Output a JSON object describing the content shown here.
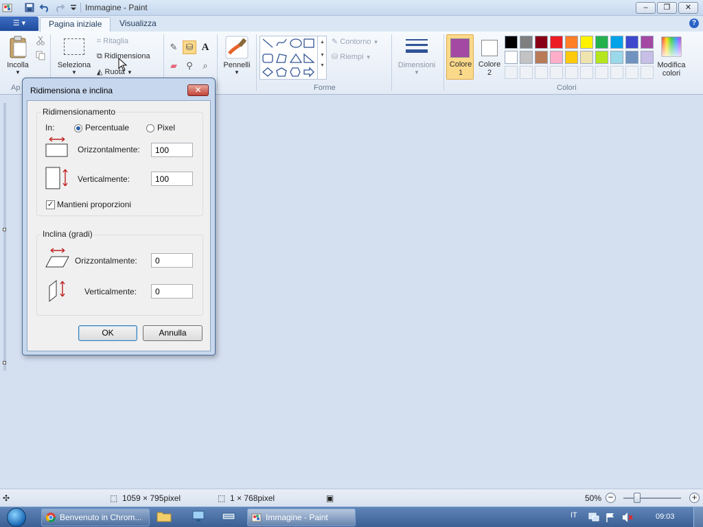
{
  "window": {
    "title": "Immagine - Paint",
    "controls": {
      "minimize": "–",
      "maximize": "❐",
      "close": "✕"
    }
  },
  "ribbon": {
    "tabs": [
      "Pagina iniziale",
      "Visualizza"
    ],
    "active_tab": "Pagina iniziale",
    "clipboard": {
      "paste_label": "Incolla",
      "group_label_partial": "Ap"
    },
    "image": {
      "select_label": "Seleziona",
      "crop_label": "Ritaglia",
      "resize_label": "Ridimensiona",
      "rotate_label": "Ruota"
    },
    "brushes_label": "Pennelli",
    "shapes": {
      "group_label": "Forme",
      "outline_label": "Contorno",
      "fill_label": "Riempi"
    },
    "size_label": "Dimensioni",
    "colors": {
      "group_label": "Colori",
      "color1_label": "Colore",
      "color1_num": "1",
      "color2_label": "Colore",
      "color2_num": "2",
      "edit_label_1": "Modifica",
      "edit_label_2": "colori",
      "color1_value": "#a349a4",
      "color2_value": "#ffffff",
      "palette_row1": [
        "#000000",
        "#7f7f7f",
        "#880015",
        "#ed1c24",
        "#ff7f27",
        "#fff200",
        "#22b14c",
        "#00a2e8",
        "#3f48cc",
        "#a349a4"
      ],
      "palette_row2": [
        "#ffffff",
        "#c3c3c3",
        "#b97a57",
        "#ffaec9",
        "#ffc90e",
        "#efe4b0",
        "#b5e61d",
        "#99d9ea",
        "#7092be",
        "#c8bfe7"
      ]
    }
  },
  "dialog": {
    "title": "Ridimensiona e inclina",
    "close": "✕",
    "resize": {
      "legend": "Ridimensionamento",
      "by_label": "In:",
      "option_percent": "Percentuale",
      "option_pixel": "Pixel",
      "selected": "Percentuale",
      "horizontal_label": "Orizzontalmente:",
      "horizontal_value": "100",
      "vertical_label": "Verticalmente:",
      "vertical_value": "100",
      "keep_ratio_label": "Mantieni proporzioni",
      "keep_ratio_checked": true
    },
    "skew": {
      "legend": "Inclina (gradi)",
      "horizontal_label": "Orizzontalmente:",
      "horizontal_value": "0",
      "vertical_label": "Verticalmente:",
      "vertical_value": "0"
    },
    "ok_label": "OK",
    "cancel_label": "Annulla"
  },
  "statusbar": {
    "selection_size": "1059 × 795pixel",
    "image_size": "1 × 768pixel",
    "zoom": "50%"
  },
  "taskbar": {
    "buttons": [
      {
        "label": "Benvenuto in Chrom...",
        "active": false
      },
      {
        "label": "Immagine - Paint",
        "active": true
      }
    ],
    "language": "IT",
    "clock": "09:03"
  }
}
